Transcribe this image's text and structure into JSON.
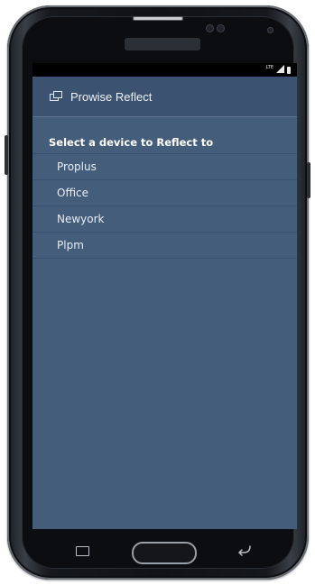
{
  "app": {
    "title": "Prowise Reflect",
    "icon": "screens-icon"
  },
  "status_bar": {
    "network_label": "LTE",
    "icons": [
      "signal-icon",
      "battery-icon"
    ]
  },
  "section_title": "Select a device to Reflect to",
  "devices": [
    {
      "label": "Proplus"
    },
    {
      "label": "Office"
    },
    {
      "label": "Newyork"
    },
    {
      "label": "Plpm"
    }
  ],
  "hardware_keys": [
    "recent-apps-key",
    "home-key",
    "back-key"
  ],
  "colors": {
    "screen_bg": "#445d7b",
    "app_bar_bg": "#3b5270",
    "text": "#e8edf3",
    "phone_body": "#101216"
  }
}
